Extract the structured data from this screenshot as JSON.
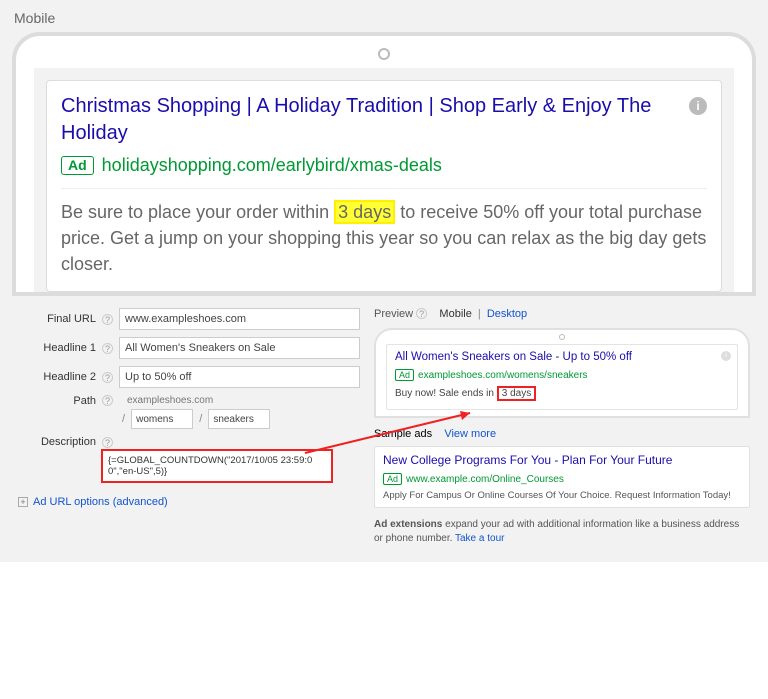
{
  "top": {
    "label": "Mobile",
    "headline": "Christmas Shopping | A Holiday Tradition | Shop Early & Enjoy The Holiday",
    "ad_badge": "Ad",
    "display_url": "holidayshopping.com/earlybird/xmas-deals",
    "desc_pre": "Be sure to place your order within",
    "desc_highlight": "3 days",
    "desc_post": "to receive 50% off your total purchase price. Get a jump on your shopping this year so you can relax as the big day gets closer."
  },
  "form": {
    "labels": {
      "final_url": "Final URL",
      "headline1": "Headline 1",
      "headline2": "Headline 2",
      "path": "Path",
      "description": "Description"
    },
    "values": {
      "final_url": "www.exampleshoes.com",
      "headline1": "All Women's Sneakers on Sale",
      "headline2": "Up to 50% off",
      "path_domain": "exampleshoes.com",
      "path1": "womens",
      "path2": "sneakers",
      "description": "{=GLOBAL_COUNTDOWN(\"2017/10/05 23:59:00\",\"en-US\",5)}"
    },
    "adv_options": "Ad URL options (advanced)"
  },
  "preview": {
    "label": "Preview",
    "tabs": {
      "mobile": "Mobile",
      "desktop": "Desktop"
    },
    "ad_badge": "Ad",
    "headline": "All Women's Sneakers on Sale - Up to 50% off",
    "display_url": "exampleshoes.com/womens/sneakers",
    "desc_pre": "Buy now! Sale ends in",
    "desc_highlight": "3 days",
    "sample_ads_label": "Sample ads",
    "view_more": "View more",
    "sample": {
      "headline": "New College Programs For You - Plan For Your Future",
      "url": "www.example.com/Online_Courses",
      "desc": "Apply For Campus Or Online Courses Of Your Choice. Request Information Today!"
    },
    "extensions": {
      "bold": "Ad extensions",
      "text": "expand your ad with additional information like a business address or phone number.",
      "link": "Take a tour"
    }
  }
}
